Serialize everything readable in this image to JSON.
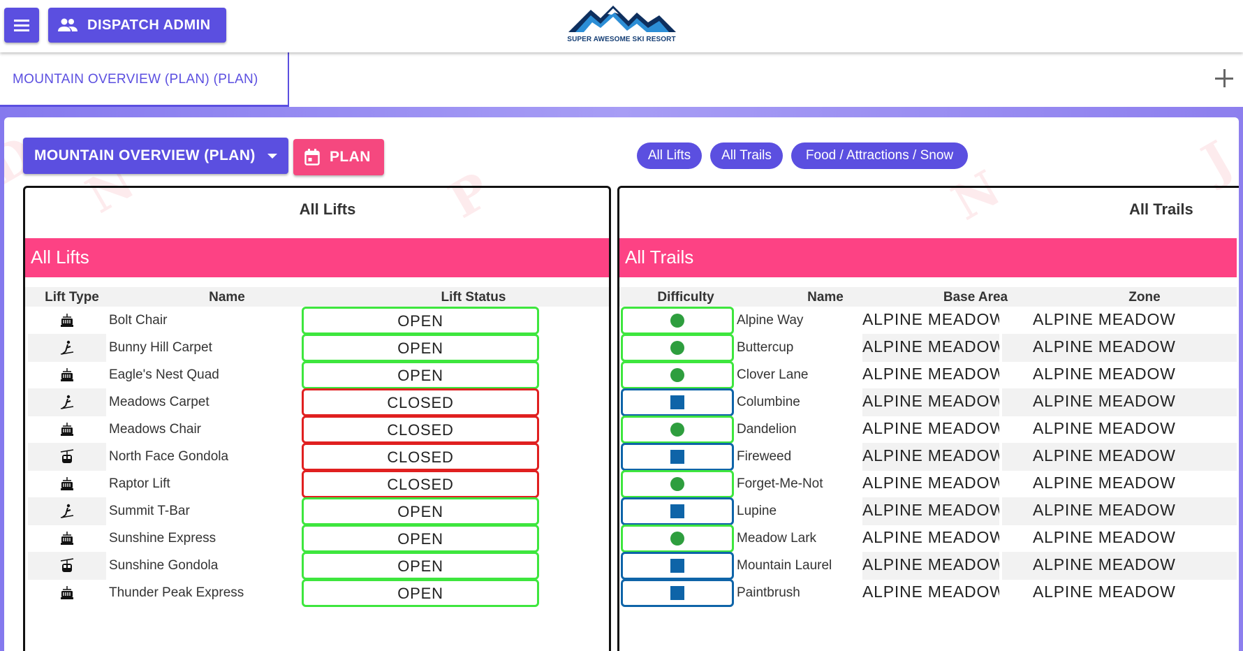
{
  "header": {
    "dispatch_label": "DISPATCH ADMIN",
    "logo_text": "SUPER AWESOME SKI RESORT"
  },
  "tabs": {
    "active_label": "MOUNTAIN OVERVIEW (PLAN) (PLAN)"
  },
  "controls": {
    "view_select_value": "MOUNTAIN OVERVIEW (PLAN)",
    "plan_label": "PLAN",
    "filters": [
      "All Lifts",
      "All Trails",
      "Food / Attractions / Snow"
    ]
  },
  "colors": {
    "accent": "#5b4fe0",
    "pink": "#fd4284",
    "open": "#3ee63e",
    "closed": "#e02020",
    "easy": "#2e9e3e",
    "intermediate": "#0e64a8"
  },
  "lifts": {
    "title": "All Lifts",
    "banner": "All Lifts",
    "columns": [
      "Lift Type",
      "Name",
      "Lift Status"
    ],
    "rows": [
      {
        "type": "chair-icon",
        "name": "Bolt Chair",
        "status": "OPEN"
      },
      {
        "type": "surface-lift-icon",
        "name": "Bunny Hill Carpet",
        "status": "OPEN"
      },
      {
        "type": "chair-icon",
        "name": "Eagle's Nest Quad",
        "status": "OPEN"
      },
      {
        "type": "surface-lift-icon",
        "name": "Meadows Carpet",
        "status": "CLOSED"
      },
      {
        "type": "chair-icon",
        "name": "Meadows Chair",
        "status": "CLOSED"
      },
      {
        "type": "gondola-icon",
        "name": "North Face Gondola",
        "status": "CLOSED"
      },
      {
        "type": "chair-icon",
        "name": "Raptor Lift",
        "status": "CLOSED"
      },
      {
        "type": "surface-lift-icon",
        "name": "Summit T-Bar",
        "status": "OPEN"
      },
      {
        "type": "chair-icon",
        "name": "Sunshine Express",
        "status": "OPEN"
      },
      {
        "type": "gondola-icon",
        "name": "Sunshine Gondola",
        "status": "OPEN"
      },
      {
        "type": "chair-icon",
        "name": "Thunder Peak Express",
        "status": "OPEN"
      }
    ]
  },
  "trails": {
    "title": "All Trails",
    "banner": "All Trails",
    "columns": [
      "Difficulty",
      "Name",
      "Base Area",
      "Zone"
    ],
    "rows": [
      {
        "difficulty": "green-circle",
        "name": "Alpine Way",
        "base": "ALPINE MEADOWS",
        "zone": "ALPINE MEADOW"
      },
      {
        "difficulty": "green-circle",
        "name": "Buttercup",
        "base": "ALPINE MEADOWS",
        "zone": "ALPINE MEADOW"
      },
      {
        "difficulty": "green-circle",
        "name": "Clover Lane",
        "base": "ALPINE MEADOWS",
        "zone": "ALPINE MEADOW"
      },
      {
        "difficulty": "blue-square",
        "name": "Columbine",
        "base": "ALPINE MEADOWS",
        "zone": "ALPINE MEADOW"
      },
      {
        "difficulty": "green-circle",
        "name": "Dandelion",
        "base": "ALPINE MEADOWS",
        "zone": "ALPINE MEADOW"
      },
      {
        "difficulty": "blue-square",
        "name": "Fireweed",
        "base": "ALPINE MEADOWS",
        "zone": "ALPINE MEADOW"
      },
      {
        "difficulty": "green-circle",
        "name": "Forget-Me-Not",
        "base": "ALPINE MEADOWS",
        "zone": "ALPINE MEADOW"
      },
      {
        "difficulty": "blue-square",
        "name": "Lupine",
        "base": "ALPINE MEADOWS",
        "zone": "ALPINE MEADOW"
      },
      {
        "difficulty": "green-circle",
        "name": "Meadow Lark",
        "base": "ALPINE MEADOWS",
        "zone": "ALPINE MEADOW"
      },
      {
        "difficulty": "blue-square",
        "name": "Mountain Laurel",
        "base": "ALPINE MEADOWS",
        "zone": "ALPINE MEADOW"
      },
      {
        "difficulty": "blue-square",
        "name": "Paintbrush",
        "base": "ALPINE MEADOWS",
        "zone": "ALPINE MEADOW"
      }
    ]
  }
}
